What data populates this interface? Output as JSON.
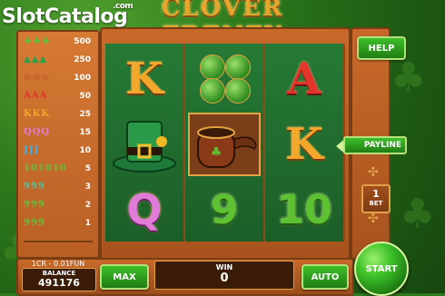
{
  "title": "CLOVER FRENZY",
  "watermark": {
    "brand": "SlotCatalog",
    "suffix": ".com"
  },
  "paytable": [
    {
      "symbol": "clover-icon",
      "label": "♣♣♣",
      "value": "500",
      "color": "#5ec132"
    },
    {
      "symbol": "hat-icon",
      "label": "▲▲▲",
      "value": "250",
      "color": "#2aa04a"
    },
    {
      "symbol": "pipe-icon",
      "label": "●●●",
      "value": "100",
      "color": "#c76a2a"
    },
    {
      "symbol": "letter-a-icon",
      "label": "AAA",
      "value": "50",
      "color": "#e4352a"
    },
    {
      "symbol": "letter-k-icon",
      "label": "KKK",
      "value": "25",
      "color": "#f3a72b"
    },
    {
      "symbol": "letter-q-icon",
      "label": "QQQ",
      "value": "15",
      "color": "#e07bd8"
    },
    {
      "symbol": "letter-j-icon",
      "label": "JJJ",
      "value": "10",
      "color": "#3cb4e8"
    },
    {
      "symbol": "number-ten-icon",
      "label": "101010",
      "value": "5",
      "color": "#5ec132"
    },
    {
      "symbol": "number-nine-icon",
      "label": "999",
      "value": "3",
      "color": "#4fc1a0"
    },
    {
      "symbol": "extra-icon",
      "label": "999",
      "value": "2",
      "color": "#5ec132"
    },
    {
      "symbol": "extra2-icon",
      "label": "999",
      "value": "1",
      "color": "#5ec132"
    }
  ],
  "reels": [
    [
      {
        "type": "letter",
        "text": "K"
      },
      {
        "type": "hat"
      },
      {
        "type": "q",
        "text": "Q"
      }
    ],
    [
      {
        "type": "clover"
      },
      {
        "type": "pipe",
        "highlight": true
      },
      {
        "type": "num",
        "text": "9"
      }
    ],
    [
      {
        "type": "letter-a",
        "text": "A"
      },
      {
        "type": "letter",
        "text": "K"
      },
      {
        "type": "num",
        "text": "10"
      }
    ]
  ],
  "buttons": {
    "help": "HELP",
    "payline": "PAYLINE",
    "max": "MAX",
    "auto": "AUTO",
    "start": "START"
  },
  "bet": {
    "value": "1",
    "label": "BET"
  },
  "balance": {
    "currency": "1CR - 0.01FUN",
    "label": "BALANCE",
    "value": "491176"
  },
  "win": {
    "label": "WIN",
    "value": "0"
  },
  "colors": {
    "accent": "#f3a72b",
    "frame": "#c8692a",
    "button_green": "#3fbf2a"
  }
}
